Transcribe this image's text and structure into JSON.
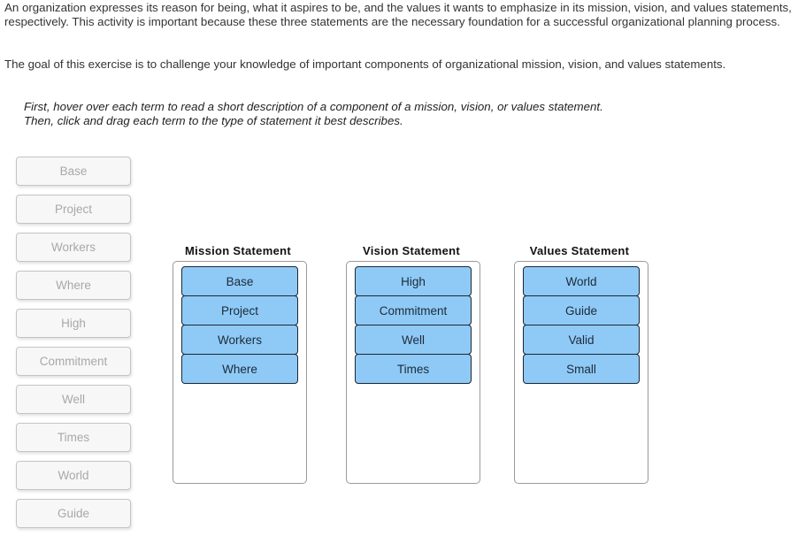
{
  "intro_text": "An organization expresses its reason for being, what it aspires to be, and the values it wants to emphasize in its mission, vision, and values statements, respectively. This activity is important because these three statements are the necessary foundation for a successful organizational planning process.",
  "goal_text": "The goal of this exercise is to challenge your knowledge of important components of organizational mission, vision, and values statements.",
  "instructions": "First, hover over each term to read a short description of a component of a mission, vision, or values statement. Then, click and drag each term to the type of statement it best describes.",
  "source_terms": [
    "Base",
    "Project",
    "Workers",
    "Where",
    "High",
    "Commitment",
    "Well",
    "Times",
    "World",
    "Guide"
  ],
  "buckets": [
    {
      "title": "Mission Statement",
      "items": [
        "Base",
        "Project",
        "Workers",
        "Where"
      ]
    },
    {
      "title": "Vision Statement",
      "items": [
        "High",
        "Commitment",
        "Well",
        "Times"
      ]
    },
    {
      "title": "Values Statement",
      "items": [
        "World",
        "Guide",
        "Valid",
        "Small"
      ]
    }
  ]
}
